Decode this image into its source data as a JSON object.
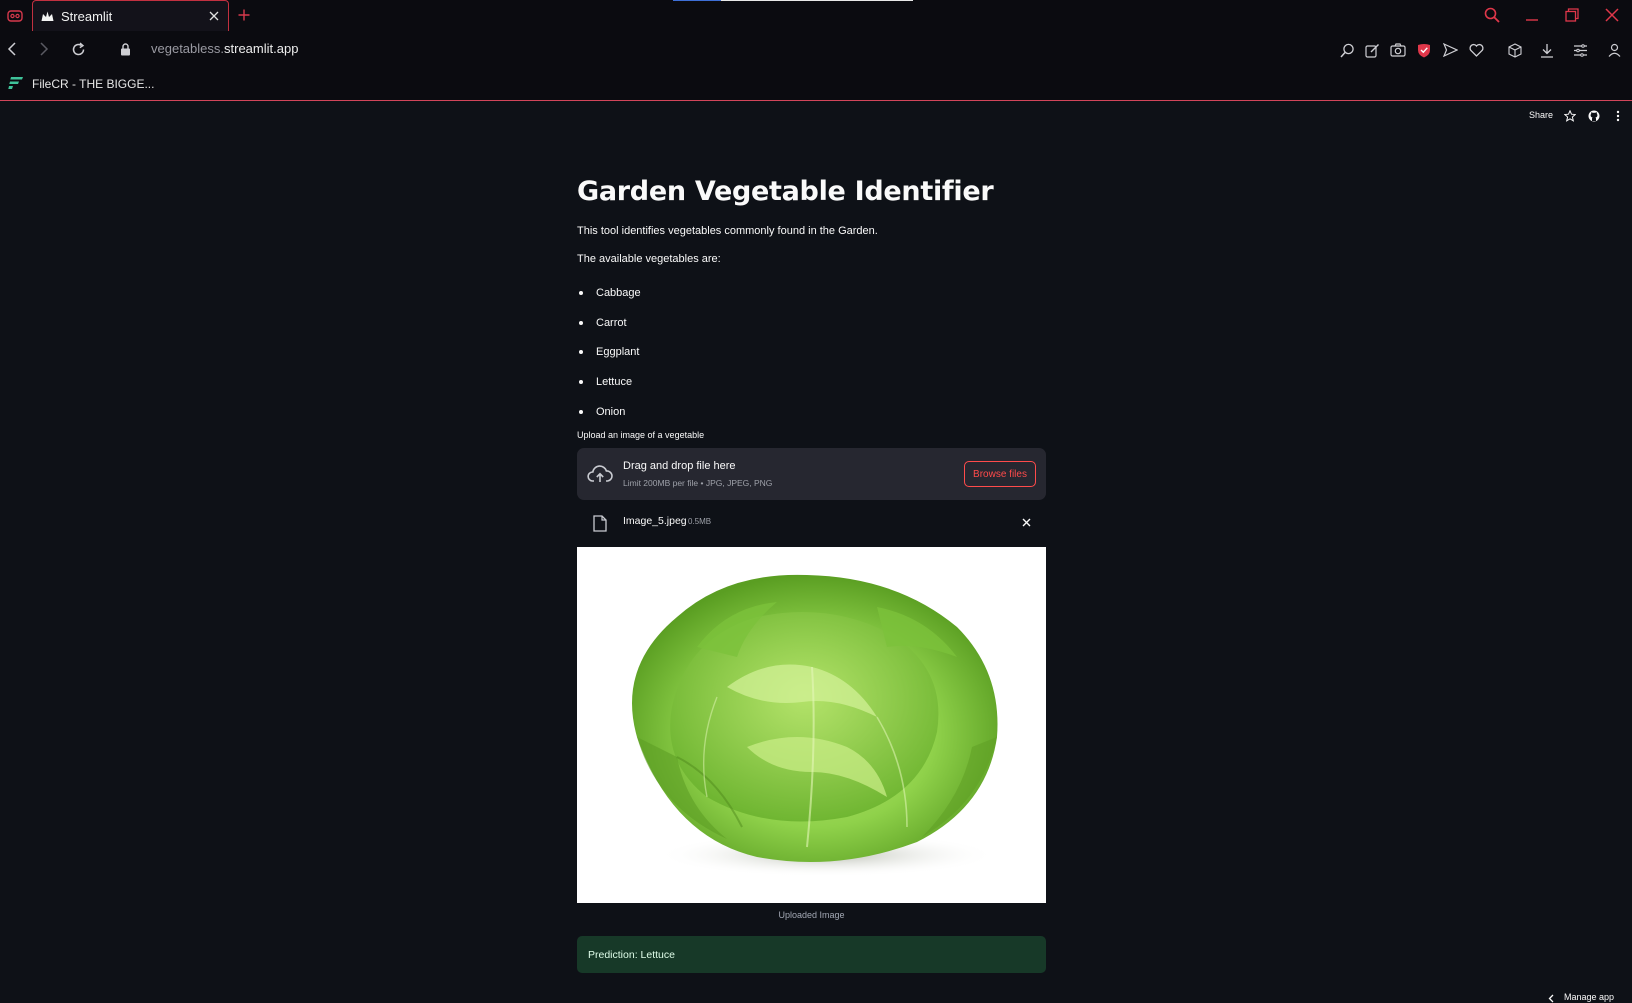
{
  "browser": {
    "tab_title": "Streamlit",
    "url_prefix": "vegetabless.",
    "url_domain": "streamlit.app",
    "bookmark_label": "FileCR - THE BIGGE...",
    "accent_color": "#e8374b"
  },
  "streamlit_header": {
    "share_label": "Share"
  },
  "app": {
    "title": "Garden Vegetable Identifier",
    "intro": "This tool identifies vegetables commonly found in the Garden.",
    "list_heading": "The available vegetables are:",
    "vegetables": [
      "Cabbage",
      "Carrot",
      "Eggplant",
      "Lettuce",
      "Onion"
    ],
    "uploader": {
      "label": "Upload an image of a vegetable",
      "drop_text": "Drag and drop file here",
      "limit_text": "Limit 200MB per file • JPG, JPEG, PNG",
      "browse_label": "Browse files",
      "file_name": "Image_5.jpeg",
      "file_size": "0.5MB"
    },
    "image_caption": "Uploaded Image",
    "prediction": "Prediction: Lettuce",
    "manage_label": "Manage app"
  },
  "colors": {
    "app_bg": "#0e1117",
    "primary": "#ff4b4b",
    "success_bg": "#173928",
    "widget_bg": "#262730"
  }
}
